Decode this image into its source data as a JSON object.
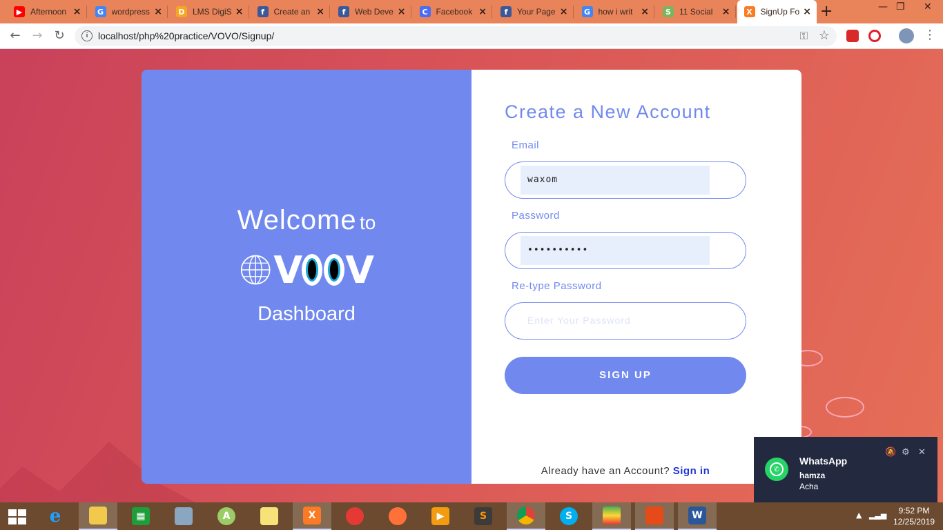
{
  "browser": {
    "tabs": [
      {
        "title": "Afternoon",
        "icon": "youtube-icon",
        "color": "#ff0000",
        "glyph": "▶"
      },
      {
        "title": "wordpress",
        "icon": "google-icon",
        "color": "#4285f4",
        "glyph": "G"
      },
      {
        "title": "LMS DigiS",
        "icon": "lms-icon",
        "color": "#f5a623",
        "glyph": "D"
      },
      {
        "title": "Create an",
        "icon": "facebook-icon",
        "color": "#3b5998",
        "glyph": "f"
      },
      {
        "title": "Web Deve",
        "icon": "facebook-icon",
        "color": "#3b5998",
        "glyph": "f"
      },
      {
        "title": "Facebook",
        "icon": "c-icon",
        "color": "#4a6cf7",
        "glyph": "C"
      },
      {
        "title": "Your Page",
        "icon": "facebook-icon",
        "color": "#3b5998",
        "glyph": "f"
      },
      {
        "title": "how i writ",
        "icon": "google-icon",
        "color": "#4285f4",
        "glyph": "G"
      },
      {
        "title": "11 Social",
        "icon": "shopify-icon",
        "color": "#7ab55c",
        "glyph": "S"
      },
      {
        "title": "SignUp Fo",
        "icon": "xampp-icon",
        "color": "#fb7a24",
        "glyph": "X"
      }
    ],
    "url": "localhost/php%20practice/VOVO/Signup/"
  },
  "welcome": {
    "prefix": "Welcome",
    "to": "to",
    "brand": "VOOV",
    "subtitle": "Dashboard"
  },
  "form": {
    "title": "Create a New Account",
    "email_label": "Email",
    "email_value": "waxom",
    "password_label": "Password",
    "password_value": "••••••••••",
    "retype_label": "Re-type Password",
    "retype_placeholder": "Enter Your Password",
    "submit_label": "SIGN UP",
    "already_text": "Already have an Account?",
    "signin_link": "Sign in"
  },
  "notification": {
    "app": "WhatsApp",
    "sender": "hamza",
    "message": "Acha"
  },
  "taskbar": {
    "time": "9:52 PM",
    "date": "12/25/2019"
  },
  "colors": {
    "accent": "#7189ef",
    "link": "#2135d6",
    "page_bg": "#d95557"
  }
}
